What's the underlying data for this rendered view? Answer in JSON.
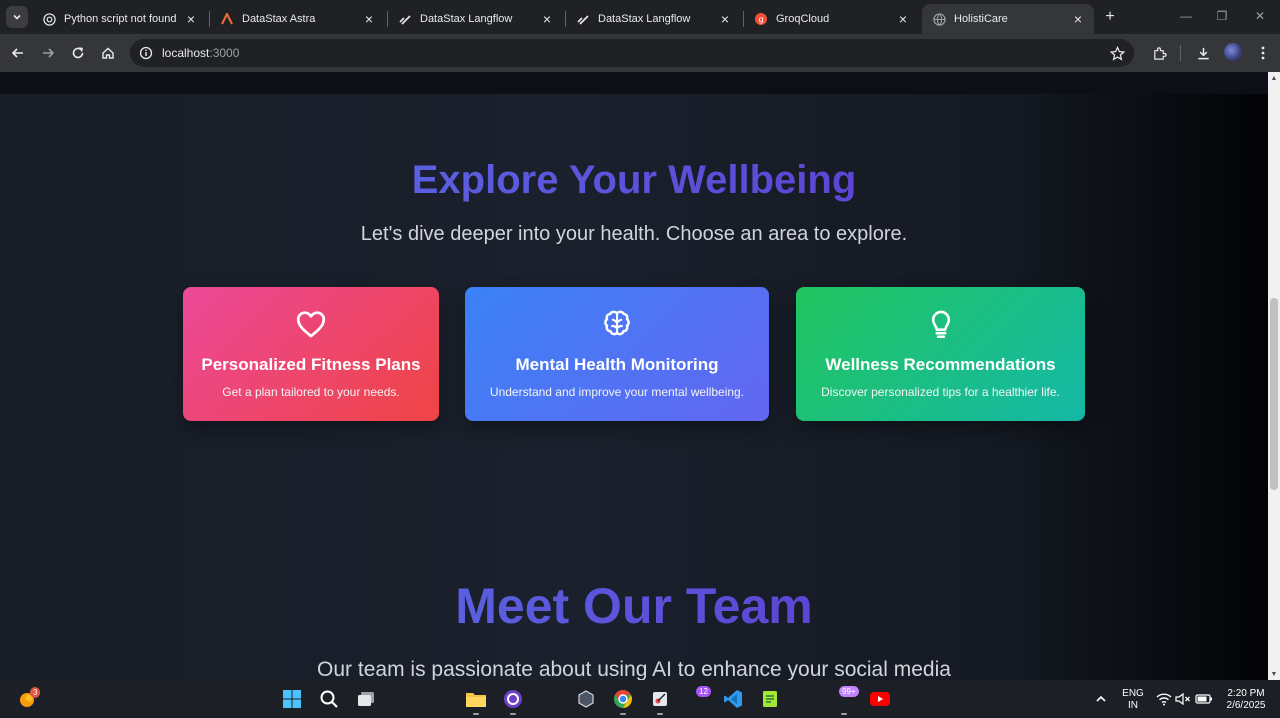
{
  "browser": {
    "tabs": [
      {
        "title": "Python script not found",
        "active": false
      },
      {
        "title": "DataStax Astra",
        "active": false
      },
      {
        "title": "DataStax Langflow",
        "active": false
      },
      {
        "title": "DataStax Langflow",
        "active": false
      },
      {
        "title": "GroqCloud",
        "active": false
      },
      {
        "title": "HolistiCare",
        "active": true
      }
    ],
    "url_host": "localhost",
    "url_port": ":3000"
  },
  "page": {
    "explore": {
      "title": "Explore Your Wellbeing",
      "subtitle": "Let's dive deeper into your health. Choose an area to explore."
    },
    "cards": [
      {
        "title": "Personalized Fitness Plans",
        "description": "Get a plan tailored to your needs.",
        "icon": "heart-icon",
        "color_from": "#ec4899",
        "color_to": "#ef4444"
      },
      {
        "title": "Mental Health Monitoring",
        "description": "Understand and improve your mental wellbeing.",
        "icon": "brain-icon",
        "color_from": "#3b82f6",
        "color_to": "#6366f1"
      },
      {
        "title": "Wellness Recommendations",
        "description": "Discover personalized tips for a healthier life.",
        "icon": "lightbulb-icon",
        "color_from": "#22c55e",
        "color_to": "#14b8a6"
      }
    ],
    "team": {
      "title": "Meet Our Team",
      "subtitle": "Our team is passionate about using AI to enhance your social media"
    }
  },
  "taskbar": {
    "notification_badge": "3",
    "widget_badge": "12",
    "app_badge": "99+",
    "language_line1": "ENG",
    "language_line2": "IN",
    "time": "2:20 PM",
    "date": "2/6/2025"
  },
  "colors": {
    "accent": "#5b4fd6",
    "page_bg": "#1a202c"
  }
}
